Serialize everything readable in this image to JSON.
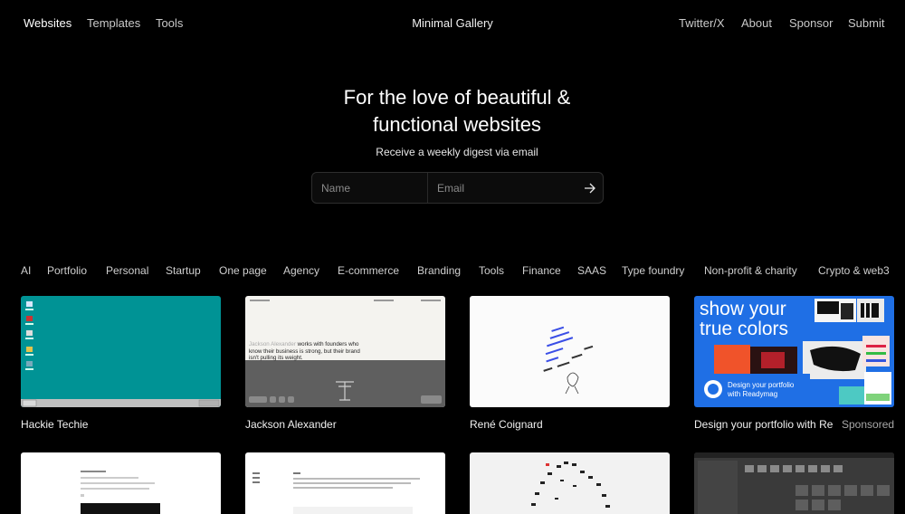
{
  "nav": {
    "left": [
      "Websites",
      "Templates",
      "Tools"
    ],
    "brand": "Minimal Gallery",
    "right": [
      "Twitter/X",
      "About",
      "Sponsor",
      "Submit"
    ]
  },
  "hero": {
    "title_line1": "For the love of beautiful &",
    "title_line2": "functional websites",
    "subtitle": "Receive a weekly digest via email",
    "name_placeholder": "Name",
    "email_placeholder": "Email"
  },
  "categories": [
    "AI",
    "Portfolio",
    "Personal",
    "Startup",
    "One page",
    "Agency",
    "E-commerce",
    "Branding",
    "Tools",
    "Finance",
    "SAAS",
    "Type foundry",
    "Non-profit & charity",
    "Crypto & web3"
  ],
  "cards": {
    "c1": {
      "title": "Hackie Techie"
    },
    "c2": {
      "title": "Jackson Alexander",
      "headline_name": "Jackson Alexander",
      "headline_rest": "works with founders who know their business is strong, but their brand isn't pulling its weight."
    },
    "c3": {
      "title": "René Coignard"
    },
    "c4": {
      "title": "Design your portfolio with Re",
      "sponsored": "Sponsored",
      "ad_text1": "show your",
      "ad_text2": "true colors",
      "ad_badge1": "Design your portfolio",
      "ad_badge2": "with Readymag"
    }
  },
  "colors": {
    "background": "#000000",
    "teal_desktop": "#009395",
    "ad_blue": "#1f6fe5"
  }
}
